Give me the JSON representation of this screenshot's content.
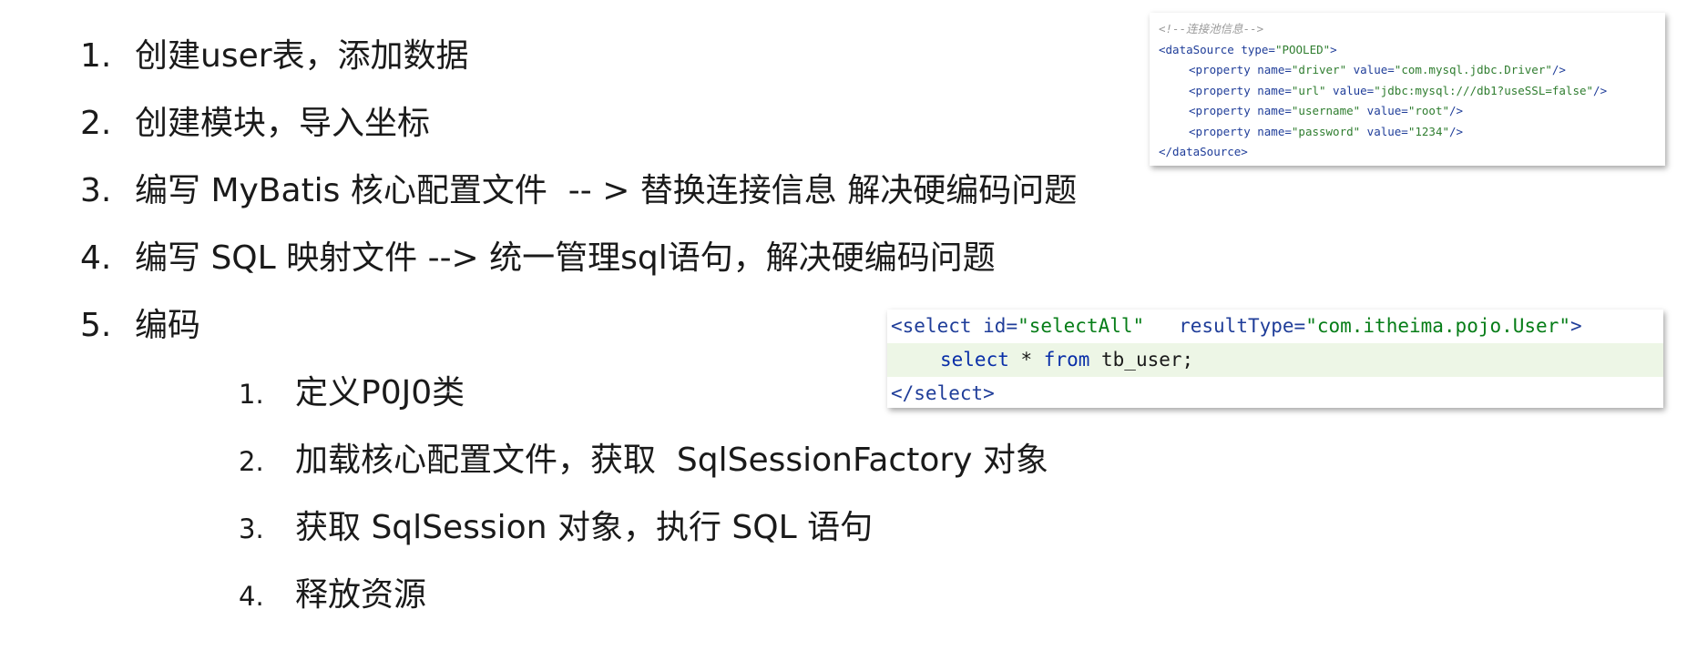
{
  "steps": [
    {
      "num": "1.",
      "text": "创建user表，添加数据"
    },
    {
      "num": "2.",
      "text": "创建模块，导入坐标"
    },
    {
      "num": "3.",
      "text": "编写 MyBatis 核心配置文件  -- > 替换连接信息 解决硬编码问题"
    },
    {
      "num": "4.",
      "text": "编写 SQL 映射文件 --> 统一管理sql语句，解决硬编码问题"
    },
    {
      "num": "5.",
      "text": "编码"
    }
  ],
  "substeps": [
    {
      "num": "1.",
      "text": "定义P0J0类"
    },
    {
      "num": "2.",
      "text": "加载核心配置文件，获取  SqlSessionFactory 对象"
    },
    {
      "num": "3.",
      "text": "获取 SqlSession 对象，执行 SQL 语句"
    },
    {
      "num": "4.",
      "text": "释放资源"
    }
  ],
  "config_snippet": {
    "comment": "<!--连接池信息-->",
    "ds_open_tag": "<dataSource",
    "ds_type_attr": " type=",
    "ds_type_val": "\"POOLED\"",
    "ds_close_bracket": ">",
    "prop_tag": "<property",
    "name_attr": " name=",
    "value_attr": " value=",
    "prop_end": "/>",
    "properties": [
      {
        "name": "\"driver\"",
        "value": "\"com.mysql.jdbc.Driver\""
      },
      {
        "name": "\"url\"",
        "value": "\"jdbc:mysql:///db1?useSSL=false\""
      },
      {
        "name": "\"username\"",
        "value": "\"root\""
      },
      {
        "name": "\"password\"",
        "value": "\"1234\""
      }
    ],
    "ds_close": "</dataSource>"
  },
  "sql_snippet": {
    "open_tag": "<select",
    "id_attr": " id=",
    "id_val": "\"selectAll\"",
    "result_attr": "   resultType=",
    "result_val": "\"com.itheima.pojo.User\"",
    "open_end": ">",
    "kw_select": "select",
    "star": " * ",
    "kw_from": "from",
    "table": " tb_user;",
    "close_tag": "</select>"
  }
}
